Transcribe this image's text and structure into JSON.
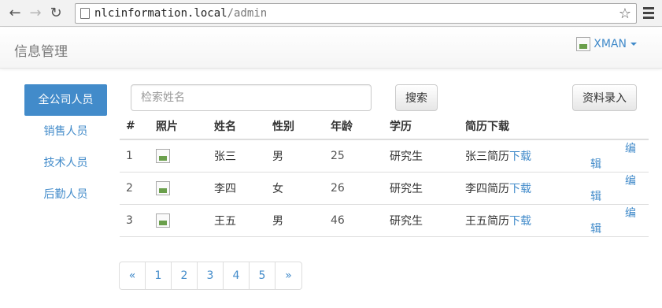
{
  "browser": {
    "url_host": "nlcinformation.local",
    "url_path": "/admin",
    "back_icon": "back-arrow-icon",
    "forward_icon": "forward-arrow-icon",
    "reload_icon": "reload-icon"
  },
  "header": {
    "brand": "信息管理",
    "user": "XMAN"
  },
  "sidebar": {
    "items": [
      {
        "label": "全公司人员",
        "active": true
      },
      {
        "label": "销售人员",
        "active": false
      },
      {
        "label": "技术人员",
        "active": false
      },
      {
        "label": "后勤人员",
        "active": false
      }
    ]
  },
  "toolbar": {
    "search_placeholder": "检索姓名",
    "search_label": "搜索",
    "add_label": "资料录入"
  },
  "table": {
    "columns": [
      "#",
      "照片",
      "姓名",
      "性别",
      "年龄",
      "学历",
      "简历下载",
      ""
    ],
    "rows": [
      {
        "id": "1",
        "name": "张三",
        "gender": "男",
        "age": "25",
        "edu": "研究生",
        "resume_prefix": "张三简历",
        "download": "下载",
        "edit": "编辑"
      },
      {
        "id": "2",
        "name": "李四",
        "gender": "女",
        "age": "26",
        "edu": "研究生",
        "resume_prefix": "李四简历",
        "download": "下载",
        "edit": "编辑"
      },
      {
        "id": "3",
        "name": "王五",
        "gender": "男",
        "age": "46",
        "edu": "研究生",
        "resume_prefix": "王五简历",
        "download": "下载",
        "edit": "编辑"
      }
    ]
  },
  "pagination": {
    "prev": "«",
    "pages": [
      "1",
      "2",
      "3",
      "4",
      "5"
    ],
    "next": "»"
  },
  "colors": {
    "accent": "#428bca"
  }
}
